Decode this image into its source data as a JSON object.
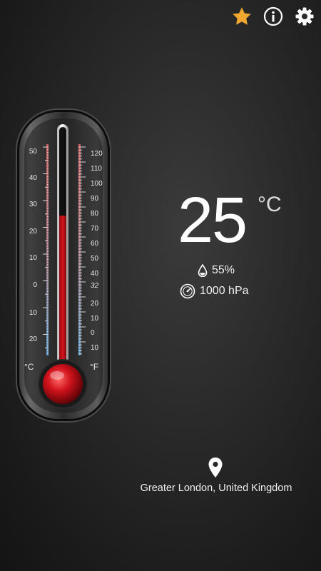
{
  "toolbar": {
    "favorite_icon": "star-icon",
    "info_icon": "info-icon",
    "settings_icon": "gear-icon",
    "star_color": "#f0a830"
  },
  "thermometer": {
    "celsius_unit": "°C",
    "fahrenheit_unit": "°F",
    "celsius_ticks": [
      "50",
      "40",
      "30",
      "20",
      "10",
      "0",
      "10",
      "20"
    ],
    "fahrenheit_ticks": [
      "120",
      "110",
      "100",
      "90",
      "80",
      "70",
      "60",
      "50",
      "40",
      "32",
      "20",
      "10",
      "0",
      "10"
    ],
    "reading_celsius": 25,
    "scale_min_celsius": -25,
    "scale_max_celsius": 53,
    "mercury_color": "#c8101a"
  },
  "reading": {
    "temperature": "25",
    "unit": "°C",
    "humidity": "55%",
    "pressure": "1000 hPa",
    "humidity_icon": "water-drop-icon",
    "pressure_icon": "barometer-icon"
  },
  "location": {
    "icon": "location-pin-icon",
    "name": "Greater London, United Kingdom"
  }
}
